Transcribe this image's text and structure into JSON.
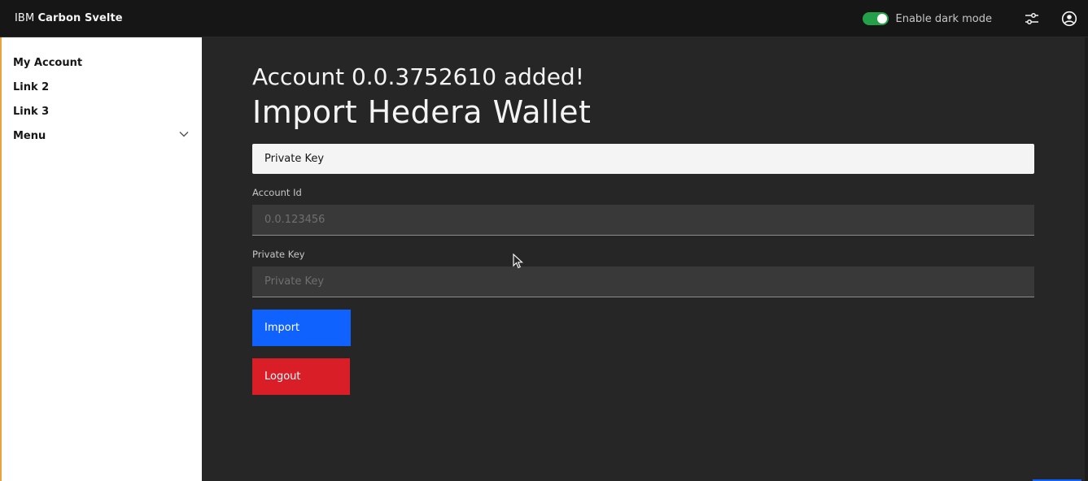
{
  "header": {
    "brand_prefix": "IBM",
    "brand_name": "Carbon Svelte",
    "dark_mode_label": "Enable dark mode",
    "dark_mode_enabled": true,
    "icons": [
      "settings-adjust-icon",
      "user-avatar-icon"
    ]
  },
  "sidebar": {
    "items": [
      {
        "label": "My Account"
      },
      {
        "label": "Link 2"
      },
      {
        "label": "Link 3"
      },
      {
        "label": "Menu"
      }
    ]
  },
  "main": {
    "notice": "Account 0.0.3752610 added!",
    "title": "Import Hedera Wallet",
    "tile_label": "Private Key",
    "account_id": {
      "label": "Account Id",
      "placeholder": "0.0.123456",
      "value": ""
    },
    "private_key": {
      "label": "Private Key",
      "placeholder": "Private Key",
      "value": ""
    },
    "import_label": "Import",
    "logout_label": "Logout"
  },
  "colors": {
    "header_bg": "#161616",
    "main_bg": "#262626",
    "toggle_on": "#24a148",
    "primary": "#0f62fe",
    "danger": "#da1e28"
  }
}
